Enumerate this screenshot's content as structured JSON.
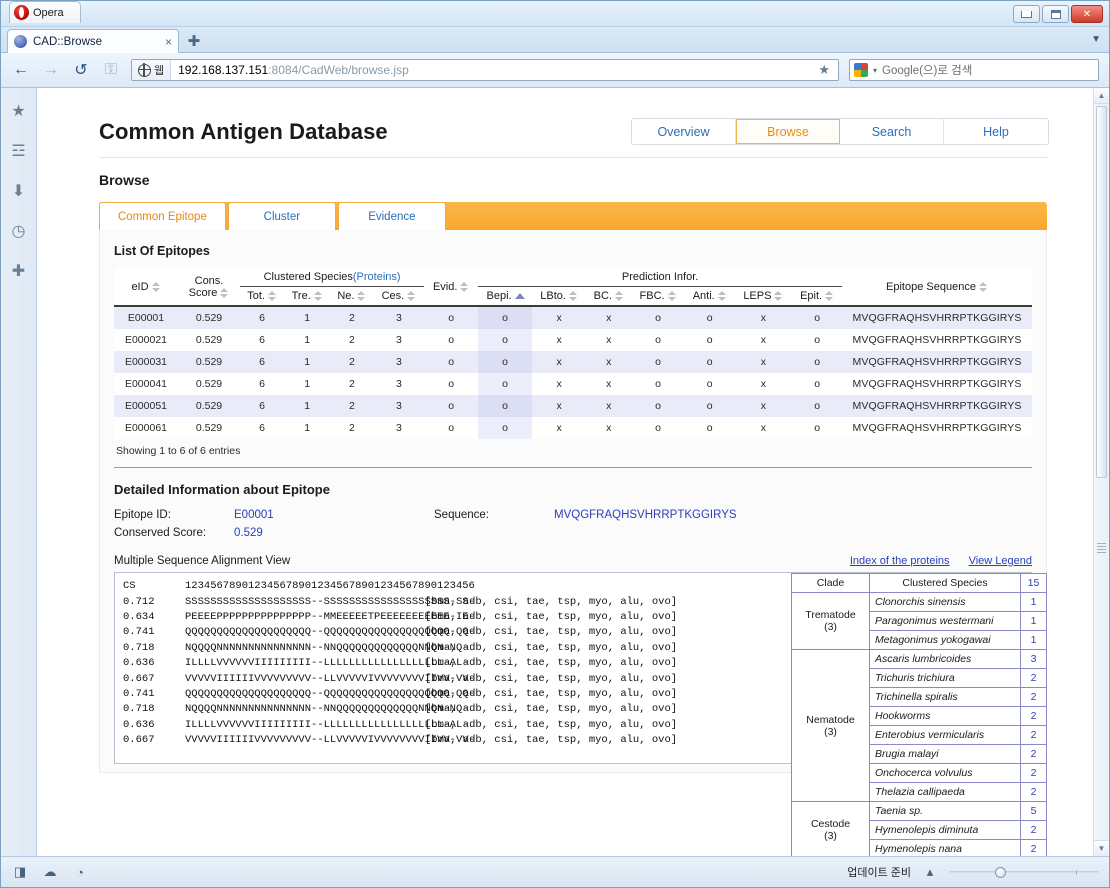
{
  "window": {
    "app_name": "Opera",
    "minimize_label": "Minimize",
    "maximize_label": "Maximize",
    "close_label": "Close"
  },
  "browser": {
    "tab_title": "CAD::Browse",
    "tab_close_glyph": "×",
    "new_tab_glyph": "✚",
    "tab_list_glyph": "▼",
    "back_glyph": "←",
    "forward_glyph": "→",
    "reload_glyph": "↺",
    "security_glyph": "⚿",
    "url_badge_label": "웹",
    "url_host": "192.168.137.151",
    "url_path": ":8084/CadWeb/browse.jsp",
    "bookmark_glyph": "★",
    "search_placeholder": "Google(으)로 검색",
    "search_caret": "▾"
  },
  "sidebar": {
    "items": [
      {
        "name": "bookmarks",
        "glyph": "★"
      },
      {
        "name": "notes",
        "glyph": "☲"
      },
      {
        "name": "downloads",
        "glyph": "⬇"
      },
      {
        "name": "history",
        "glyph": "◷"
      },
      {
        "name": "add-panel",
        "glyph": "✚"
      }
    ]
  },
  "site": {
    "title": "Common Antigen Database",
    "nav": [
      {
        "label": "Overview",
        "active": false
      },
      {
        "label": "Browse",
        "active": true
      },
      {
        "label": "Search",
        "active": false
      },
      {
        "label": "Help",
        "active": false
      }
    ],
    "page_heading": "Browse",
    "inner_tabs": [
      {
        "label": "Common Epitope",
        "active": true
      },
      {
        "label": "Cluster",
        "active": false
      },
      {
        "label": "Evidence",
        "active": false
      }
    ],
    "list_heading": "List Of Epitopes"
  },
  "table": {
    "group_headers": {
      "clustered_species": "Clustered Species",
      "clustered_species_link": "(Proteins)",
      "prediction": "Prediction Infor."
    },
    "columns": [
      "eID",
      "Cons. Score",
      "Tot.",
      "Tre.",
      "Ne.",
      "Ces.",
      "Evid.",
      "Bepi.",
      "LBto.",
      "BC.",
      "FBC.",
      "Anti.",
      "LEPS",
      "Epit.",
      "Epitope Sequence"
    ],
    "sorted_column": "Bepi.",
    "sort_direction": "asc",
    "rows": [
      {
        "eid": "E00001",
        "score": "0.529",
        "tot": "6",
        "tre": "1",
        "ne": "2",
        "ces": "3",
        "evid": "o",
        "bepi": "o",
        "lbto": "x",
        "bc": "x",
        "fbc": "o",
        "anti": "o",
        "leps": "x",
        "epit": "o",
        "sequence": "MVQGFRAQHSVHRRPTKGGIRYS"
      },
      {
        "eid": "E000021",
        "score": "0.529",
        "tot": "6",
        "tre": "1",
        "ne": "2",
        "ces": "3",
        "evid": "o",
        "bepi": "o",
        "lbto": "x",
        "bc": "x",
        "fbc": "o",
        "anti": "o",
        "leps": "x",
        "epit": "o",
        "sequence": "MVQGFRAQHSVHRRPTKGGIRYS"
      },
      {
        "eid": "E000031",
        "score": "0.529",
        "tot": "6",
        "tre": "1",
        "ne": "2",
        "ces": "3",
        "evid": "o",
        "bepi": "o",
        "lbto": "x",
        "bc": "x",
        "fbc": "o",
        "anti": "o",
        "leps": "x",
        "epit": "o",
        "sequence": "MVQGFRAQHSVHRRPTKGGIRYS"
      },
      {
        "eid": "E000041",
        "score": "0.529",
        "tot": "6",
        "tre": "1",
        "ne": "2",
        "ces": "3",
        "evid": "o",
        "bepi": "o",
        "lbto": "x",
        "bc": "x",
        "fbc": "o",
        "anti": "o",
        "leps": "x",
        "epit": "o",
        "sequence": "MVQGFRAQHSVHRRPTKGGIRYS"
      },
      {
        "eid": "E000051",
        "score": "0.529",
        "tot": "6",
        "tre": "1",
        "ne": "2",
        "ces": "3",
        "evid": "o",
        "bepi": "o",
        "lbto": "x",
        "bc": "x",
        "fbc": "o",
        "anti": "o",
        "leps": "x",
        "epit": "o",
        "sequence": "MVQGFRAQHSVHRRPTKGGIRYS"
      },
      {
        "eid": "E000061",
        "score": "0.529",
        "tot": "6",
        "tre": "1",
        "ne": "2",
        "ces": "3",
        "evid": "o",
        "bepi": "o",
        "lbto": "x",
        "bc": "x",
        "fbc": "o",
        "anti": "o",
        "leps": "x",
        "epit": "o",
        "sequence": "MVQGFRAQHSVHRRPTKGGIRYS"
      }
    ],
    "entries_info": "Showing 1 to 6 of 6 entries"
  },
  "detail": {
    "heading": "Detailed Information about Epitope",
    "epitope_id_label": "Epitope ID:",
    "epitope_id_value": "E00001",
    "sequence_label": "Sequence:",
    "sequence_value": "MVQGFRAQHSVHRRPTKGGIRYS",
    "conserved_label": "Conserved Score:",
    "conserved_value": "0.529",
    "msa_title": "Multiple Sequence Alignment View",
    "msa_link_index": "Index of the proteins",
    "msa_link_legend": "View Legend",
    "msa_rows": [
      {
        "cs": "CS",
        "seq": "1234567890123456789012345678901234567890123456",
        "species": ""
      },
      {
        "cs": "0.712",
        "seq": "SSSSSSSSSSSSSSSSSSSS--SSSSSSSSSSSSSSSSSSSS-SS-",
        "species": "[bma, adb, csi, tae, tsp, myo, alu, ovo]"
      },
      {
        "cs": "0.634",
        "seq": "PEEEEPPPPPPPPPPPPPPP--MMEEEEETPEEEEEEEEEEE-IE-",
        "species": "[bma, adb, csi, tae, tsp, myo, alu, ovo]"
      },
      {
        "cs": "0.741",
        "seq": "QQQQQQQQQQQQQQQQQQQQ--QQQQQQQQQQQQQQQQQQQQ-QQ-",
        "species": "[bma, adb, csi, tae, tsp, myo, alu, ovo]"
      },
      {
        "cs": "0.718",
        "seq": "NQQQQNNNNNNNNNNNNNNN--NNQQQQQQQQQQQQQNNQN-NQ-",
        "species": "[bma, adb, csi, tae, tsp, myo, alu, ovo]"
      },
      {
        "cs": "0.636",
        "seq": "ILLLLVVVVVVIIIIIIIII--LLLLLLLLLLLLLLLLLLL-AL-",
        "species": "[bma, adb, csi, tae, tsp, myo, alu, ovo]"
      },
      {
        "cs": "0.667",
        "seq": "VVVVVIIIIIIVVVVVVVVV--LLVVVVVIVVVVVVVVIIVV-VV-",
        "species": "[bma, adb, csi, tae, tsp, myo, alu, ovo]"
      },
      {
        "cs": "0.741",
        "seq": "QQQQQQQQQQQQQQQQQQQQ--QQQQQQQQQQQQQQQQQQQQ-QQ-",
        "species": "[bma, adb, csi, tae, tsp, myo, alu, ovo]"
      },
      {
        "cs": "0.718",
        "seq": "NQQQQNNNNNNNNNNNNNNN--NNQQQQQQQQQQQQQNNQN-NQ-",
        "species": "[bma, adb, csi, tae, tsp, myo, alu, ovo]"
      },
      {
        "cs": "0.636",
        "seq": "ILLLLVVVVVVIIIIIIIII--LLLLLLLLLLLLLLLLLLL-AL-",
        "species": "[bma, adb, csi, tae, tsp, myo, alu, ovo]"
      },
      {
        "cs": "0.667",
        "seq": "VVVVVIIIIIIVVVVVVVVV--LLVVVVVIVVVVVVVVIIVV-VV-",
        "species": "[bma, adb, csi, tae, tsp, myo, alu, ovo]"
      }
    ]
  },
  "species_table": {
    "header": {
      "clade": "Clade",
      "species": "Clustered Species",
      "count": "15"
    },
    "groups": [
      {
        "clade": "Trematode",
        "clade_count": "(3)",
        "species": [
          {
            "name": "Clonorchis sinensis",
            "count": "1"
          },
          {
            "name": "Paragonimus westermani",
            "count": "1"
          },
          {
            "name": "Metagonimus yokogawai",
            "count": "1"
          }
        ]
      },
      {
        "clade": "Nematode",
        "clade_count": "(3)",
        "species": [
          {
            "name": "Ascaris lumbricoides",
            "count": "3"
          },
          {
            "name": "Trichuris trichiura",
            "count": "2"
          },
          {
            "name": "Trichinella spiralis",
            "count": "2"
          },
          {
            "name": "Hookworms",
            "count": "2"
          },
          {
            "name": "Enterobius vermicularis",
            "count": "2"
          },
          {
            "name": "Brugia malayi",
            "count": "2"
          },
          {
            "name": "Onchocerca volvulus",
            "count": "2"
          },
          {
            "name": "Thelazia callipaeda",
            "count": "2"
          }
        ]
      },
      {
        "clade": "Cestode",
        "clade_count": "(3)",
        "species": [
          {
            "name": "Taenia sp.",
            "count": "5"
          },
          {
            "name": "Hymenolepis diminuta",
            "count": "2"
          },
          {
            "name": "Hymenolepis nana",
            "count": "2"
          }
        ]
      }
    ]
  },
  "statusbar": {
    "panel_glyph": "◨",
    "opera_turbo_glyph": "☁",
    "unite_glyph": "◔",
    "update_text": "업데이트 준비",
    "zoom_caret": "▴"
  },
  "colors": {
    "accent_orange": "#e79016",
    "link_blue": "#2a6ebb",
    "row_alt": "#e9ecf8",
    "sorted_col": "#dcdff4"
  }
}
